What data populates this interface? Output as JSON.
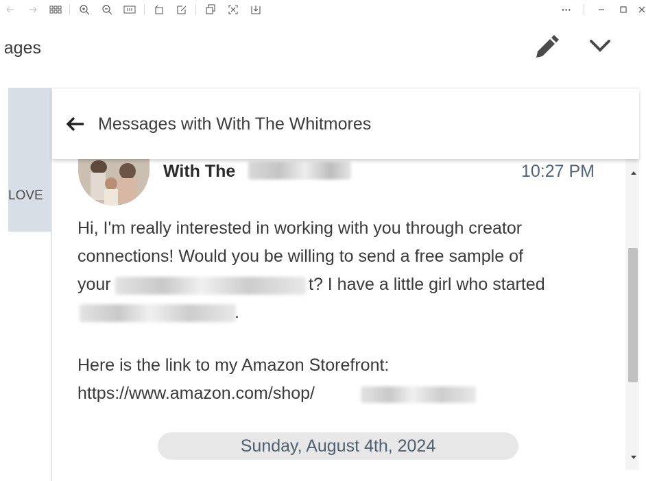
{
  "toolbar": {
    "icons": [
      "back-icon",
      "forward-icon",
      "grid-icon",
      "zoom-in-icon",
      "zoom-out-icon",
      "fit-icon",
      "rotate-icon",
      "edit-icon",
      "copy-icon",
      "fullscreen-icon",
      "download-icon",
      "more-icon",
      "minimize-icon",
      "maximize-icon",
      "close-icon"
    ],
    "more_label": "···"
  },
  "app_header": {
    "title": "ages",
    "icons": [
      "pencil-icon",
      "chevron-down-icon"
    ]
  },
  "left_panel": {
    "label": "LOVE",
    "color": "#d7dee5"
  },
  "conversation": {
    "header_title": "Messages with With The Whitmores",
    "sender_name_visible": "With The",
    "timestamp": "10:27 PM",
    "message_lines": [
      "Hi, I'm really interested in working with you through creator",
      "connections! Would you be willing to send a free sample of",
      "your",
      "t? I have a little girl who started",
      "."
    ],
    "storefront_intro": "Here is the link to my Amazon Storefront:",
    "storefront_link": "https://www.amazon.com/shop/",
    "date_divider": "Sunday, August 4th, 2024"
  },
  "colors": {
    "accent_text": "#556473",
    "body_text": "#3a3a3a",
    "pill_bg": "#e7e7e7"
  }
}
